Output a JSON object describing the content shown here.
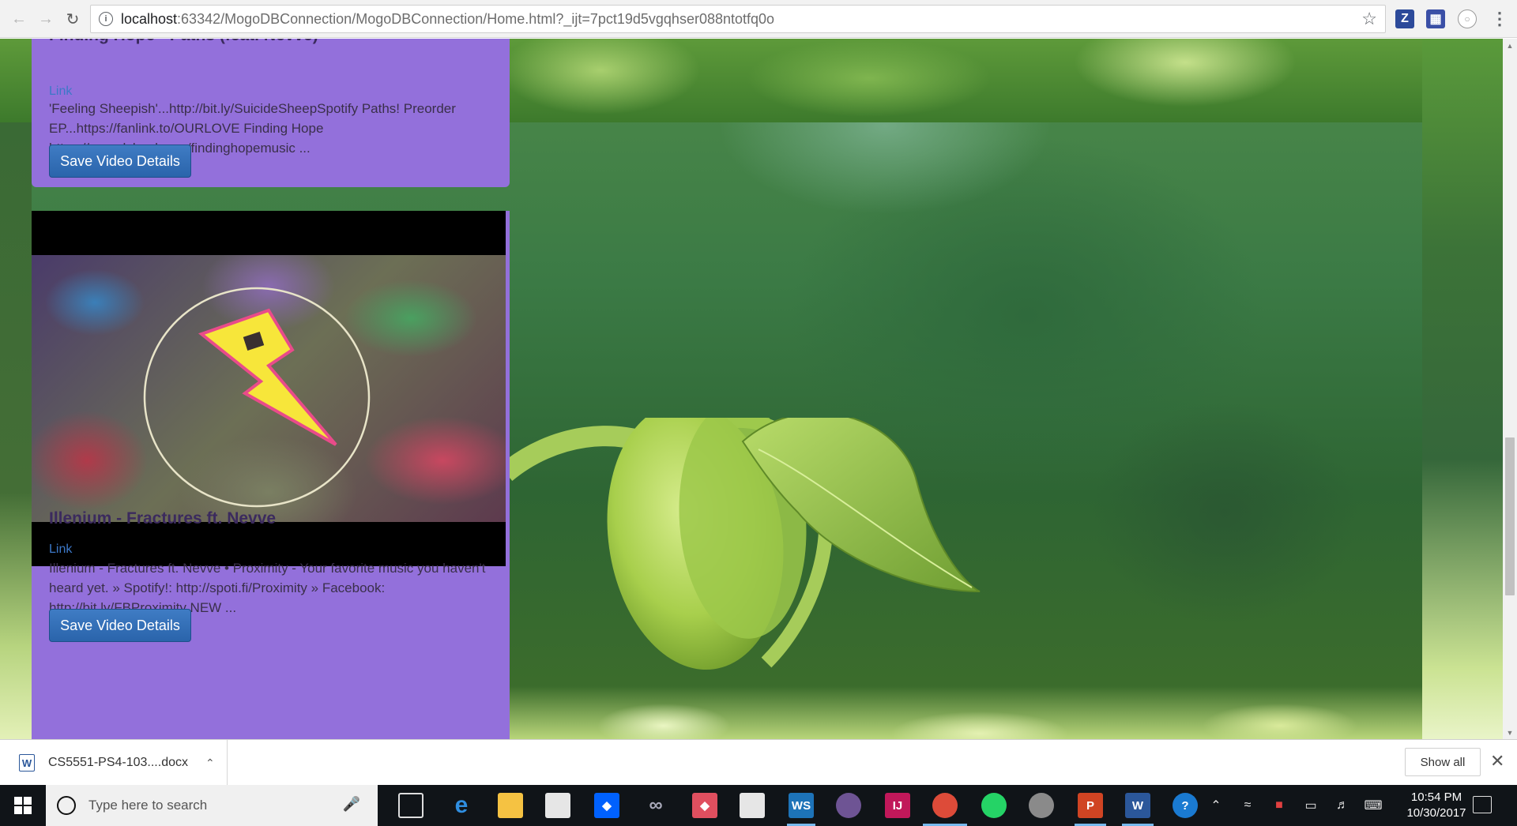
{
  "browser": {
    "url_host": "localhost",
    "url_rest": ":63342/MogoDBConnection/MogoDBConnection/Home.html?_ijt=7pct19d5vgqhser088ntotfq0o",
    "ext_z": "Z"
  },
  "cards": [
    {
      "title": "Finding Hope - Paths (feat. Nevve)",
      "link": "Link",
      "description": "'Feeling Sheepish'...http://bit.ly/SuicideSheepSpotify Paths! Preorder EP...https://fanlink.to/OURLOVE Finding Hope https://soundcloud.com/findinghopemusic ...",
      "button": "Save Video Details"
    },
    {
      "title": "Illenium - Fractures ft. Nevve",
      "link": "Link",
      "description": "Illenium - Fractures ft. Nevve • Proximity - Your favorite music you haven't heard yet. » Spotify!: http://spoti.fi/Proximity » Facebook: http://bit.ly/FBProximity NEW ...",
      "button": "Save Video Details"
    }
  ],
  "download": {
    "filename": "CS5551-PS4-103....docx",
    "icon_letter": "W",
    "show_all": "Show all"
  },
  "taskbar": {
    "search_placeholder": "Type here to search",
    "time": "10:54 PM",
    "date": "10/30/2017"
  }
}
